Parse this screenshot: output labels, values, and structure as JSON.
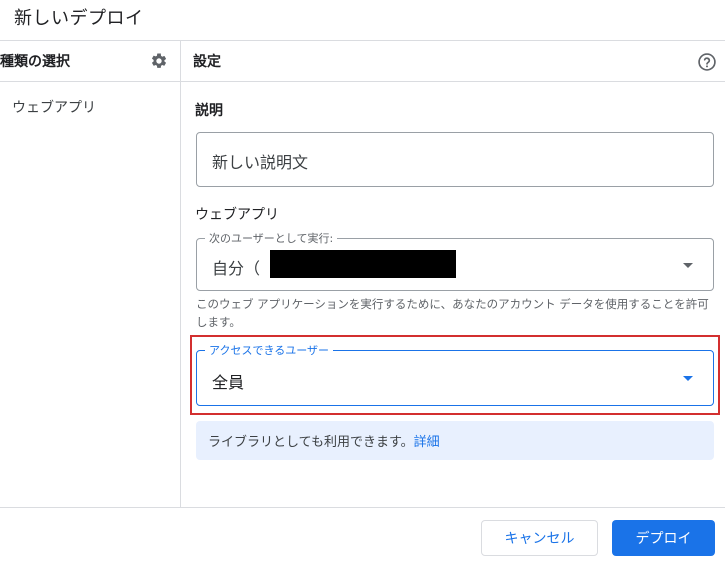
{
  "dialog": {
    "title": "新しいデプロイ"
  },
  "left_panel": {
    "header": "種類の選択",
    "settings_icon": "gear-icon",
    "items": [
      {
        "label": "ウェブアプリ"
      }
    ]
  },
  "right_panel": {
    "header": "設定",
    "help_icon": "help-circle-icon",
    "description": {
      "label": "説明",
      "value": "新しい説明文"
    },
    "webapp_section": {
      "label": "ウェブアプリ",
      "execute_as": {
        "legend": "次のユーザーとして実行:",
        "value": "自分（"
      },
      "helper_text": "このウェブ アプリケーションを実行するために、あなたのアカウント データを使用することを許可します。",
      "access": {
        "legend": "アクセスできるユーザー",
        "value": "全員"
      }
    },
    "info": {
      "text": "ライブラリとしても利用できます。",
      "link": "詳細"
    }
  },
  "footer": {
    "cancel_label": "キャンセル",
    "deploy_label": "デプロイ"
  },
  "colors": {
    "accent": "#1a73e8",
    "highlight_border": "#d32f2f",
    "info_bg": "#e8f0fe"
  }
}
